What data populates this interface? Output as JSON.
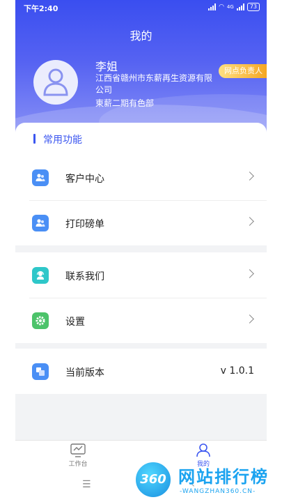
{
  "status": {
    "time": "下午2:40",
    "network": "4G",
    "battery": "73"
  },
  "header": {
    "title": "我的",
    "user_name": "李姐",
    "company": "江西省赣州市东薪再生资源有限公司",
    "department": "東薪二期有色部",
    "role_badge": "网点负责人"
  },
  "section": {
    "title": "常用功能"
  },
  "menu_groups": [
    [
      {
        "label": "客户中心",
        "icon": "customer-icon",
        "color": "#4a8ff5"
      },
      {
        "label": "打印磅单",
        "icon": "print-icon",
        "color": "#4a8ff5"
      }
    ],
    [
      {
        "label": "联系我们",
        "icon": "contact-icon",
        "color": "#2ec7c9"
      },
      {
        "label": "设置",
        "icon": "gear-icon",
        "color": "#4cc36a"
      }
    ],
    [
      {
        "label": "当前版本",
        "icon": "version-icon",
        "color": "#4a8ff5",
        "value": "v 1.0.1"
      }
    ]
  ],
  "tabbar": {
    "work_label": "工作台",
    "mine_label": "我的"
  },
  "navbar": {
    "menu_glyph": "☰",
    "back_glyph": "‹"
  },
  "watermark": {
    "logo_text": "360",
    "title": "网站排行榜",
    "url": "-WANGZHAN360.CN-"
  },
  "colors": {
    "accent": "#3b56f0",
    "header_top": "#3a4ef0",
    "badge": "#f5a623"
  }
}
